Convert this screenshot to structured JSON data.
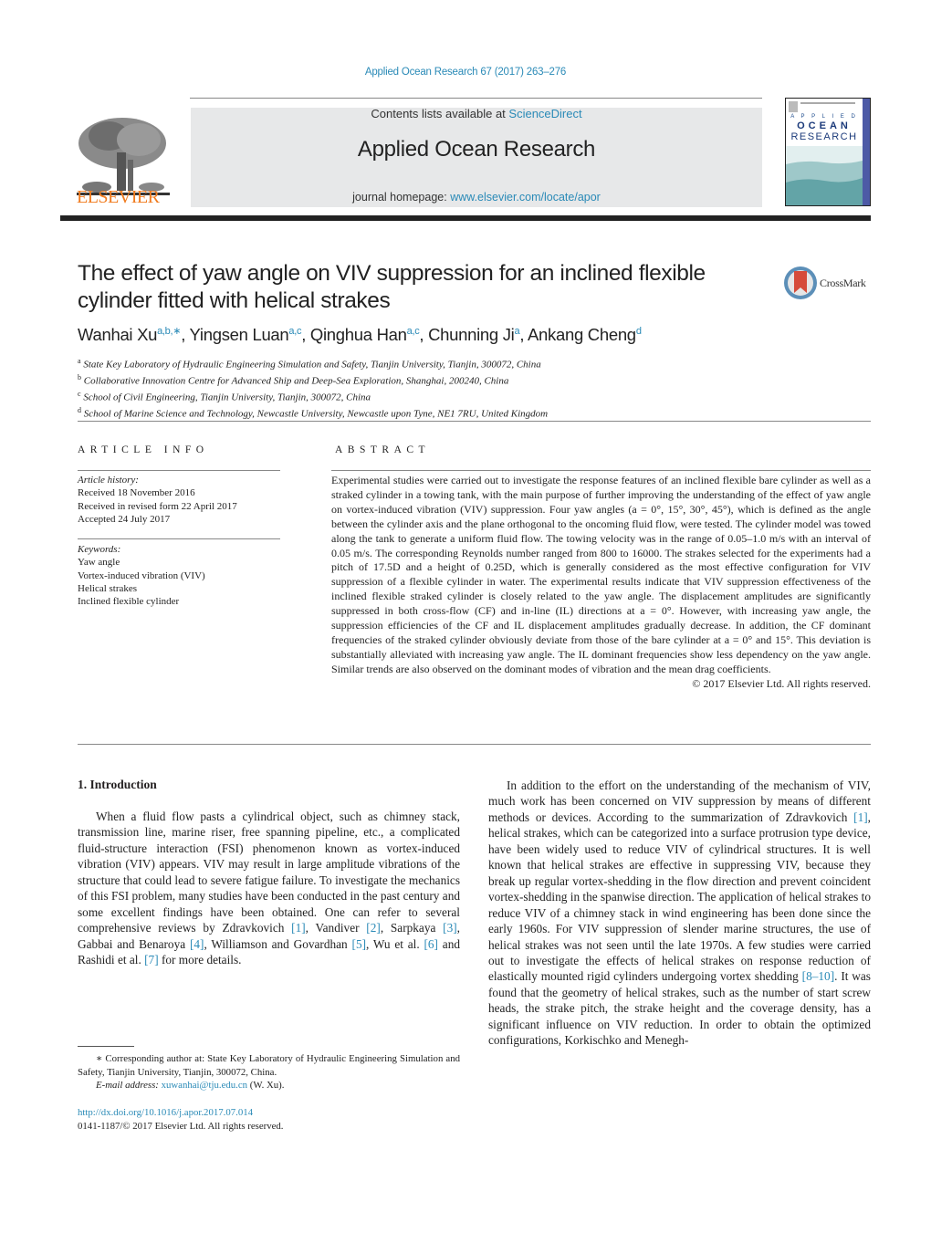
{
  "header": {
    "citation": "Applied Ocean Research 67 (2017) 263–276",
    "contents_prefix": "Contents lists available at ",
    "contents_link": "ScienceDirect",
    "journal_title": "Applied Ocean Research",
    "homepage_prefix": "journal homepage: ",
    "homepage_link": "www.elsevier.com/locate/apor",
    "publisher": "ELSEVIER",
    "cover": {
      "line1": "A P P L I E D",
      "line2": "OCEAN",
      "line3": "RESEARCH"
    },
    "colors": {
      "link": "#2a8ab7",
      "elsevier_orange": "#f07b1e",
      "banner_bg": "#e7e8e9"
    }
  },
  "article": {
    "title": "The effect of yaw angle on VIV suppression for an inclined flexible cylinder fitted with helical strakes",
    "crossmark_label": "CrossMark",
    "authors": [
      {
        "name": "Wanhai Xu",
        "sup": "a,b,∗",
        "sep": ", "
      },
      {
        "name": "Yingsen Luan",
        "sup": "a,c",
        "sep": ", "
      },
      {
        "name": "Qinghua Han",
        "sup": "a,c",
        "sep": ", "
      },
      {
        "name": "Chunning Ji",
        "sup": "a",
        "sep": ", "
      },
      {
        "name": "Ankang Cheng",
        "sup": "d",
        "sep": ""
      }
    ],
    "affiliations": [
      {
        "key": "a",
        "text": "State Key Laboratory of Hydraulic Engineering Simulation and Safety, Tianjin University, Tianjin, 300072, China"
      },
      {
        "key": "b",
        "text": "Collaborative Innovation Centre for Advanced Ship and Deep-Sea Exploration, Shanghai, 200240, China"
      },
      {
        "key": "c",
        "text": "School of Civil Engineering, Tianjin University, Tianjin, 300072, China"
      },
      {
        "key": "d",
        "text": "School of Marine Science and Technology, Newcastle University, Newcastle upon Tyne, NE1 7RU, United Kingdom"
      }
    ]
  },
  "article_info": {
    "heading": "ARTICLE INFO",
    "history_label": "Article history:",
    "history": [
      "Received 18 November 2016",
      "Received in revised form 22 April 2017",
      "Accepted 24 July 2017"
    ],
    "keywords_label": "Keywords:",
    "keywords": [
      "Yaw angle",
      "Vortex-induced vibration (VIV)",
      "Helical strakes",
      "Inclined flexible cylinder"
    ]
  },
  "abstract": {
    "heading": "ABSTRACT",
    "text": "Experimental studies were carried out to investigate the response features of an inclined flexible bare cylinder as well as a straked cylinder in a towing tank, with the main purpose of further improving the understanding of the effect of yaw angle on vortex-induced vibration (VIV) suppression. Four yaw angles (a = 0°, 15°, 30°, 45°), which is defined as the angle between the cylinder axis and the plane orthogonal to the oncoming fluid flow, were tested. The cylinder model was towed along the tank to generate a uniform fluid flow. The towing velocity was in the range of 0.05–1.0 m/s with an interval of 0.05 m/s. The corresponding Reynolds number ranged from 800 to 16000. The strakes selected for the experiments had a pitch of 17.5D and a height of 0.25D, which is generally considered as the most effective configuration for VIV suppression of a flexible cylinder in water. The experimental results indicate that VIV suppression effectiveness of the inclined flexible straked cylinder is closely related to the yaw angle. The displacement amplitudes are significantly suppressed in both cross-flow (CF) and in-line (IL) directions at a = 0°. However, with increasing yaw angle, the suppression efficiencies of the CF and IL displacement amplitudes gradually decrease. In addition, the CF dominant frequencies of the straked cylinder obviously deviate from those of the bare cylinder at a = 0° and 15°. This deviation is substantially alleviated with increasing yaw angle. The IL dominant frequencies show less dependency on the yaw angle. Similar trends are also observed on the dominant modes of vibration and the mean drag coefficients.",
    "copyright": "© 2017 Elsevier Ltd. All rights reserved."
  },
  "introduction": {
    "heading": "1.  Introduction",
    "col1_p1_a": "When a fluid flow pasts a cylindrical object, such as chimney stack, transmission line, marine riser, free spanning pipeline, etc., a complicated fluid-structure interaction (FSI) phenomenon known as vortex-induced vibration (VIV) appears. VIV may result in large amplitude vibrations of the structure that could lead to severe fatigue failure. To investigate the mechanics of this FSI problem, many studies have been conducted in the past century and some excellent findings have been obtained. One can refer to several comprehensive reviews by Zdravkovich ",
    "refs": [
      "[1]",
      "[2]",
      "[3]",
      "[4]",
      "[5]",
      "[6]",
      "[7]",
      "[1]",
      "[8–10]"
    ],
    "col1_t2": ", Vandiver ",
    "col1_t3": ", Sarpkaya ",
    "col1_t4": ", Gabbai and Benaroya ",
    "col1_t5": ", Williamson and Govardhan ",
    "col1_t6": ", Wu et al. ",
    "col1_t7": " and Rashidi et al. ",
    "col1_t8": " for more details.",
    "col2_a": "In addition to the effort on the understanding of the mechanism of VIV, much work has been concerned on VIV suppression by means of different methods or devices. According to the summarization of Zdravkovich ",
    "col2_b": ", helical strakes, which can be categorized into a surface protrusion type device, have been widely used to reduce VIV of cylindrical structures. It is well known that helical strakes are effective in suppressing VIV, because they break up regular vortex-shedding in the flow direction and prevent coincident vortex-shedding in the spanwise direction. The application of helical strakes to reduce VIV of a chimney stack in wind engineering has been done since the early 1960s. For VIV suppression of slender marine structures, the use of helical strakes was not seen until the late 1970s. A few studies were carried out to investigate the effects of helical strakes on response reduction of elastically mounted rigid cylinders undergoing vortex shedding ",
    "col2_c": ". It was found that the geometry of helical strakes, such as the number of start screw heads, the strake pitch, the strake height and the coverage density, has a significant influence on VIV reduction. In order to obtain the optimized configurations, Korkischko and Menegh-"
  },
  "footnotes": {
    "corresponding": "∗  Corresponding author at: State Key Laboratory of Hydraulic Engineering Simulation and Safety, Tianjin University, Tianjin, 300072, China.",
    "email_label": "E-mail address: ",
    "email": "xuwanhai@tju.edu.cn",
    "email_suffix": " (W. Xu).",
    "doi": "http://dx.doi.org/10.1016/j.apor.2017.07.014",
    "issn": "0141-1187/© 2017 Elsevier Ltd. All rights reserved."
  }
}
